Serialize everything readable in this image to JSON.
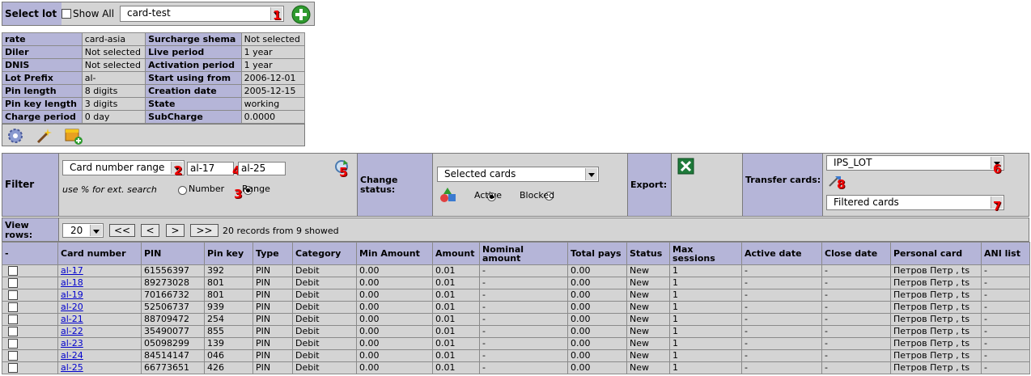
{
  "lot_bar": {
    "select_label": "Select lot",
    "show_all_label": "Show All",
    "lot_value": "card-test",
    "marker1": "1"
  },
  "info": {
    "rows": [
      {
        "k1": "rate",
        "v1": "card-asia",
        "k2": "Surcharge shema",
        "v2": "Not selected"
      },
      {
        "k1": "Diler",
        "v1": "Not selected",
        "k2": "Live period",
        "v2": "1 year"
      },
      {
        "k1": "DNIS",
        "v1": "Not selected",
        "k2": "Activation period",
        "v2": "1 year"
      },
      {
        "k1": "Lot Prefix",
        "v1": "al-",
        "k2": "Start using from",
        "v2": "2006-12-01"
      },
      {
        "k1": "Pin length",
        "v1": "8 digits",
        "k2": "Creation date",
        "v2": "2005-12-15"
      },
      {
        "k1": "Pin key length",
        "v1": "3 digits",
        "k2": "State",
        "v2": "working"
      },
      {
        "k1": "Charge period",
        "v1": "0 day",
        "k2": "SubCharge",
        "v2": "0.0000"
      }
    ]
  },
  "filter": {
    "label": "Filter",
    "field_value": "Card number range",
    "from_value": "al-17",
    "to_value": "al-25",
    "hint": "use % for ext. search",
    "radio_number": "Number",
    "radio_range": "Range",
    "marker2": "2",
    "marker3": "3",
    "marker4": "4",
    "marker5": "5"
  },
  "change_status": {
    "label": "Change status:",
    "target_value": "Selected cards",
    "radio_active": "Active",
    "radio_blocked": "Blocked"
  },
  "export": {
    "label": "Export:"
  },
  "transfer": {
    "label": "Transfer cards:",
    "lot_value": "IPS_LOT",
    "scope_value": "Filtered cards",
    "marker6": "6",
    "marker7": "7",
    "marker8": "8"
  },
  "view": {
    "label": "View rows:",
    "rows_value": "20",
    "first": "<<",
    "prev": "<",
    "next": ">",
    "last": ">>",
    "status": "20 records from 9 showed"
  },
  "table": {
    "headers": [
      "-",
      "Card number",
      "PIN",
      "Pin key",
      "Type",
      "Category",
      "Min Amount",
      "Amount",
      "Nominal amount",
      "Total pays",
      "Status",
      "Max sessions",
      "Active date",
      "Close date",
      "Personal card",
      "ANI list"
    ],
    "rows": [
      [
        "al-17",
        "61556397",
        "392",
        "PIN",
        "Debit",
        "0.00",
        "0.01",
        "-",
        "0.00",
        "New",
        "1",
        "-",
        "-",
        "Петров Петр , ts",
        "-"
      ],
      [
        "al-18",
        "89273028",
        "801",
        "PIN",
        "Debit",
        "0.00",
        "0.01",
        "-",
        "0.00",
        "New",
        "1",
        "-",
        "-",
        "Петров Петр , ts",
        "-"
      ],
      [
        "al-19",
        "70166732",
        "801",
        "PIN",
        "Debit",
        "0.00",
        "0.01",
        "-",
        "0.00",
        "New",
        "1",
        "-",
        "-",
        "Петров Петр , ts",
        "-"
      ],
      [
        "al-20",
        "52506737",
        "939",
        "PIN",
        "Debit",
        "0.00",
        "0.01",
        "-",
        "0.00",
        "New",
        "1",
        "-",
        "-",
        "Петров Петр , ts",
        "-"
      ],
      [
        "al-21",
        "88709472",
        "254",
        "PIN",
        "Debit",
        "0.00",
        "0.01",
        "-",
        "0.00",
        "New",
        "1",
        "-",
        "-",
        "Петров Петр , ts",
        "-"
      ],
      [
        "al-22",
        "35490077",
        "855",
        "PIN",
        "Debit",
        "0.00",
        "0.01",
        "-",
        "0.00",
        "New",
        "1",
        "-",
        "-",
        "Петров Петр , ts",
        "-"
      ],
      [
        "al-23",
        "05098299",
        "139",
        "PIN",
        "Debit",
        "0.00",
        "0.01",
        "-",
        "0.00",
        "New",
        "1",
        "-",
        "-",
        "Петров Петр , ts",
        "-"
      ],
      [
        "al-24",
        "84514147",
        "046",
        "PIN",
        "Debit",
        "0.00",
        "0.01",
        "-",
        "0.00",
        "New",
        "1",
        "-",
        "-",
        "Петров Петр , ts",
        "-"
      ],
      [
        "al-25",
        "66773651",
        "426",
        "PIN",
        "Debit",
        "0.00",
        "0.01",
        "-",
        "0.00",
        "New",
        "1",
        "-",
        "-",
        "Петров Петр , ts",
        "-"
      ]
    ]
  },
  "colors": {
    "header_bg": "#b5b5d8",
    "cell_bg": "#d4d4d4",
    "link": "#0000cc",
    "marker": "#ee0000"
  }
}
